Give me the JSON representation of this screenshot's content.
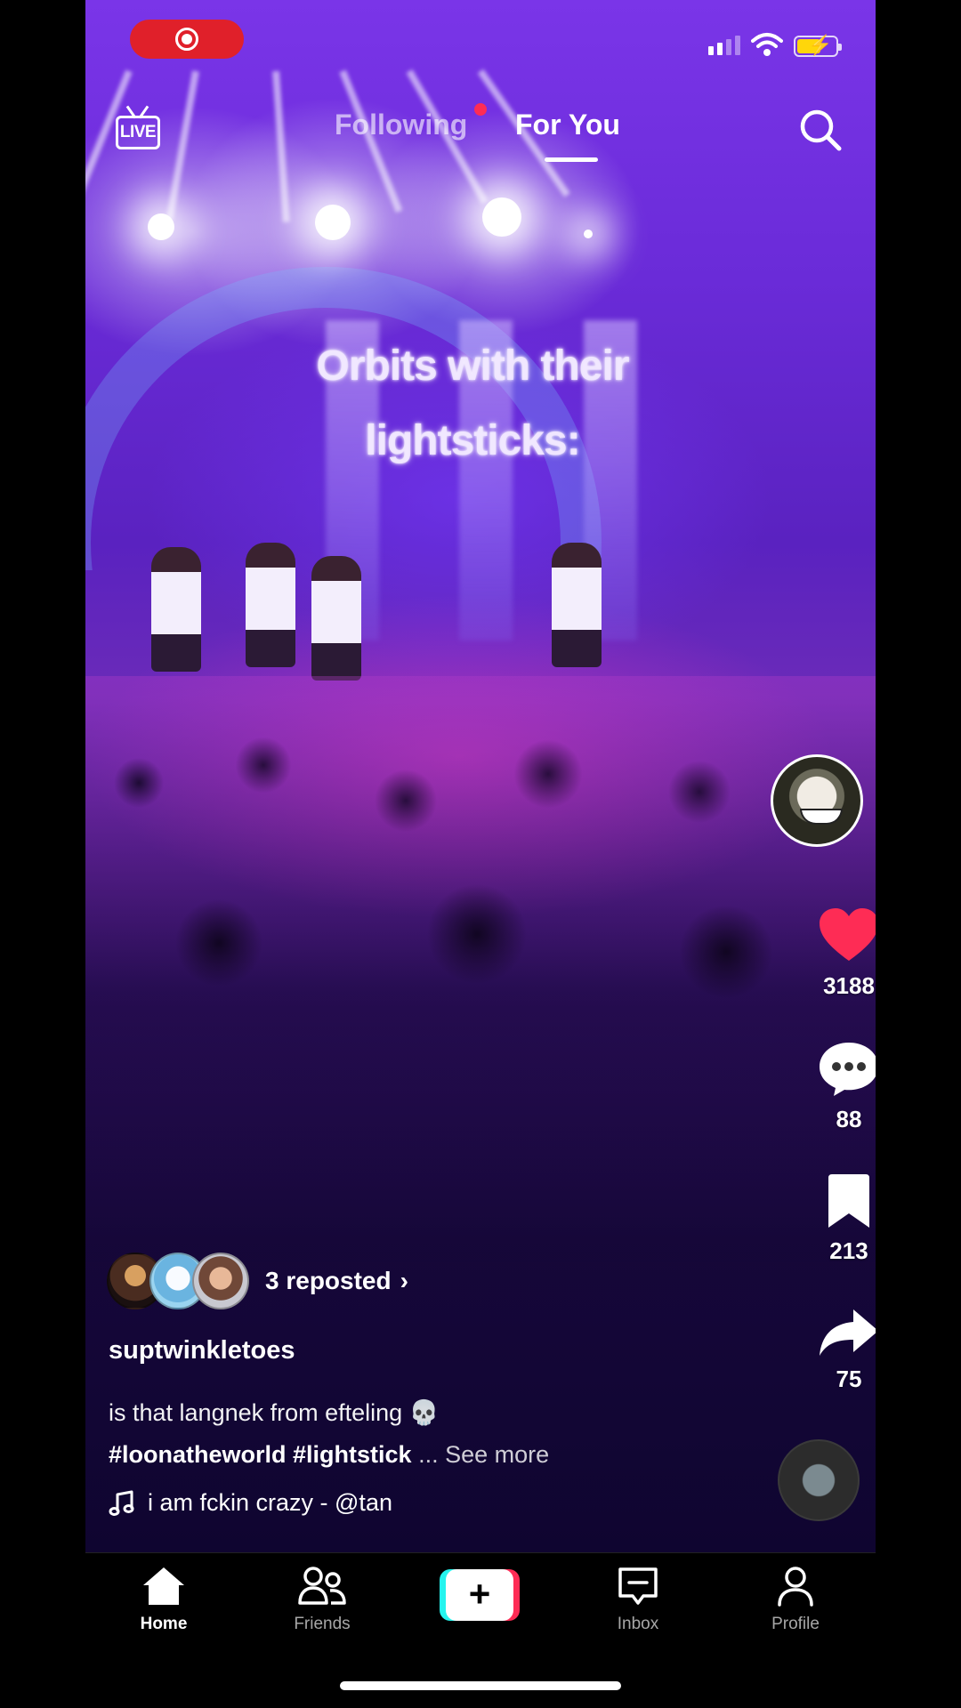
{
  "status_bar": {
    "recording": true,
    "battery_color": "#ffd60a"
  },
  "top_nav": {
    "live_label": "LIVE",
    "tabs": [
      {
        "label": "Following",
        "active": false,
        "has_dot": true
      },
      {
        "label": "For You",
        "active": true
      }
    ]
  },
  "video": {
    "overlay_line1": "Orbits with their",
    "overlay_line2": "lightsticks:"
  },
  "right_rail": {
    "follow_symbol": "+",
    "likes": "3188",
    "comments": "88",
    "bookmarks": "213",
    "shares": "75",
    "like_color": "#fe2c55"
  },
  "post": {
    "reposted_label": "3 reposted",
    "reposted_chevron": "›",
    "username": "suptwinkletoes",
    "caption": "is that langnek from efteling",
    "caption_emoji": "💀",
    "hashtag1": "#loonatheworld",
    "hashtag2": "#lightstick",
    "see_more": "... See more",
    "sound": "i am fckin crazy - @tan"
  },
  "bottom_nav": {
    "items": [
      {
        "label": "Home",
        "icon": "home-icon",
        "active": true
      },
      {
        "label": "Friends",
        "icon": "friends-icon",
        "active": false
      },
      {
        "label": "+",
        "icon": "create-icon"
      },
      {
        "label": "Inbox",
        "icon": "inbox-icon",
        "active": false
      },
      {
        "label": "Profile",
        "icon": "profile-icon",
        "active": false
      }
    ]
  },
  "colors": {
    "accent": "#fe2c55",
    "create_cyan": "#25f4ee"
  }
}
